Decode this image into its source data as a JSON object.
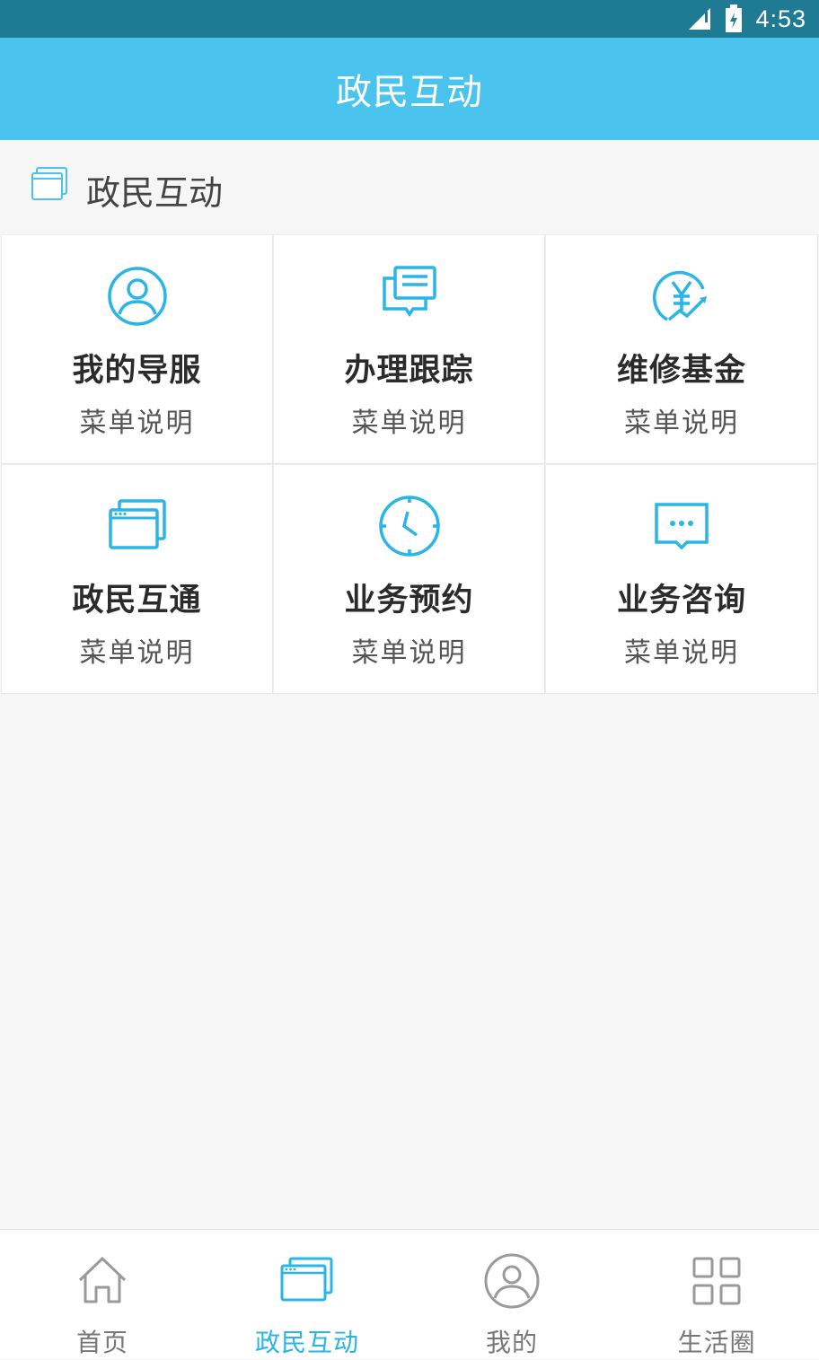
{
  "status_bar": {
    "time": "4:53"
  },
  "app_bar": {
    "title": "政民互动"
  },
  "section": {
    "title": "政民互动"
  },
  "menu": [
    {
      "title": "我的导服",
      "desc": "菜单说明",
      "icon": "user-circle-icon"
    },
    {
      "title": "办理跟踪",
      "desc": "菜单说明",
      "icon": "document-chat-icon"
    },
    {
      "title": "维修基金",
      "desc": "菜单说明",
      "icon": "yen-circle-icon"
    },
    {
      "title": "政民互通",
      "desc": "菜单说明",
      "icon": "browser-windows-icon"
    },
    {
      "title": "业务预约",
      "desc": "菜单说明",
      "icon": "clock-icon"
    },
    {
      "title": "业务咨询",
      "desc": "菜单说明",
      "icon": "chat-bubble-icon"
    }
  ],
  "tabs": [
    {
      "label": "首页",
      "icon": "home-icon",
      "active": false
    },
    {
      "label": "政民互动",
      "icon": "browser-windows-icon",
      "active": true
    },
    {
      "label": "我的",
      "icon": "user-circle-icon",
      "active": false
    },
    {
      "label": "生活圈",
      "icon": "grid-icon",
      "active": false
    }
  ],
  "colors": {
    "accent": "#2ab5e6",
    "app_bar": "#4ac4ee",
    "status_bar": "#1f7b93",
    "inactive": "#9a9a9a"
  }
}
